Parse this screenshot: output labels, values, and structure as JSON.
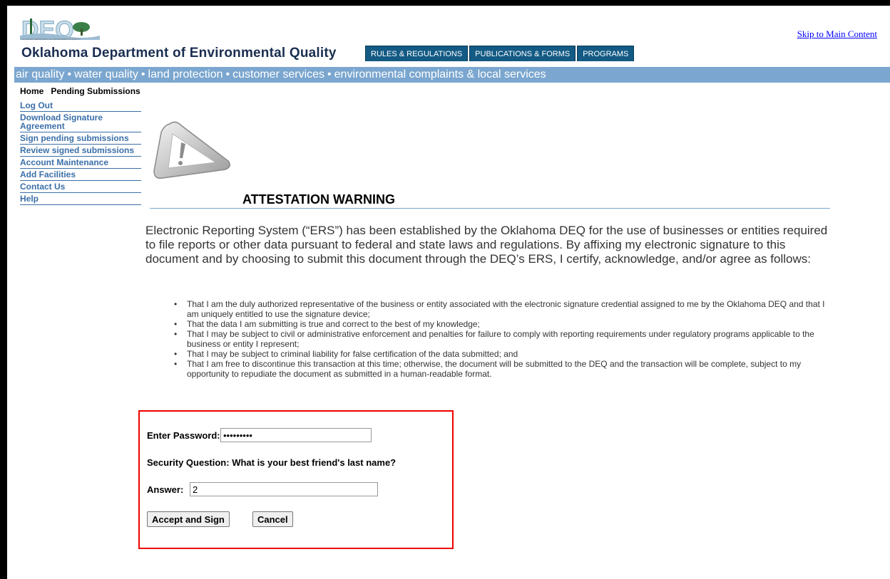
{
  "header": {
    "logo_letters": "DEQ",
    "logo_small_text": "OKLAHOMA DEPARTMENT OF ENVIRONMENTAL QUALITY",
    "org_name": "Oklahoma Department of Environmental Quality",
    "skip_link": "Skip to Main Content",
    "tabs": [
      {
        "label": "RULES & REGULATIONS"
      },
      {
        "label": "PUBLICATIONS & FORMS"
      },
      {
        "label": "PROGRAMS"
      }
    ]
  },
  "program_bar": {
    "items": [
      "air quality",
      "water quality",
      "land protection",
      "customer services",
      "environmental complaints & local services"
    ]
  },
  "breadcrumb": {
    "items": [
      "Home",
      "Pending Submissions"
    ]
  },
  "sidebar": {
    "items": [
      {
        "label": "Log Out"
      },
      {
        "label": "Download Signature Agreement"
      },
      {
        "label": "Sign pending submissions"
      },
      {
        "label": "Review signed submissions"
      },
      {
        "label": "Account Maintenance"
      },
      {
        "label": "Add Facilities"
      },
      {
        "label": "Contact Us"
      },
      {
        "label": "Help"
      }
    ]
  },
  "main": {
    "warning_icon": "warning-triangle-icon",
    "title": "ATTESTATION WARNING",
    "intro": "Electronic Reporting System (“ERS”) has been established by the Oklahoma DEQ for the use of businesses or entities required to file reports or other data pursuant to federal and state laws and regulations. By affixing my electronic signature to this document and by choosing to submit this document through the DEQ’s ERS, I certify, acknowledge, and/or agree as follows:",
    "bullets": [
      "That I am the duly authorized representative of the business or entity associated with the electronic signature credential assigned to me by the Oklahoma DEQ and that I am uniquely entitled to use the signature device;",
      "That the data I am submitting is true and correct to the best of my knowledge;",
      "That I may be subject to civil or administrative enforcement and penalties for failure to comply with reporting requirements under regulatory programs applicable to the business or entity I represent;",
      "That I may be subject to criminal liability for false certification of the data submitted; and",
      "That I am free to discontinue this transaction at this time; otherwise, the document will be submitted to the DEQ and the transaction will be complete, subject to my opportunity to repudiate the document as submitted in a human-readable format."
    ]
  },
  "sign_form": {
    "password_label": "Enter Password:",
    "password_value": "•••••••••",
    "security_question": "Security Question: What is your best friend's last name?",
    "answer_label": "Answer:",
    "answer_value": "2",
    "accept_button": "Accept and Sign",
    "cancel_button": "Cancel"
  },
  "colors": {
    "tab_bg": "#135a84",
    "program_bar_bg": "#7aa6cf",
    "sidebar_link": "#3b6fa8",
    "highlight_border": "#e00000"
  }
}
